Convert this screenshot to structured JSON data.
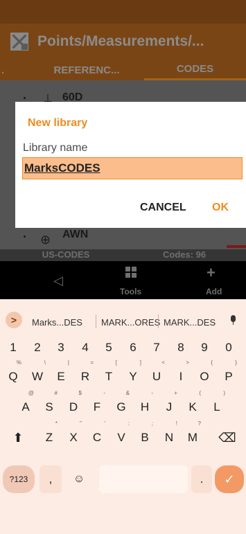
{
  "app": {
    "title": "Points/Measurements/...",
    "tabs": [
      {
        "label": "."
      },
      {
        "label": "REFERENC..."
      },
      {
        "label": "CODES"
      }
    ],
    "list": [
      {
        "code": "60D",
        "symbol": "⊥"
      },
      {
        "code": "AWN",
        "symbol": "⊕"
      }
    ],
    "footer": {
      "library": "US-CODES",
      "count": "Codes: 96"
    },
    "bottom": {
      "back_glyph": "◁",
      "tools_label": "Tools",
      "add_glyph": "+",
      "add_label": "Add"
    }
  },
  "dialog": {
    "title": "New library",
    "field_label": "Library name",
    "field_value": "MarksCODES",
    "cancel": "CANCEL",
    "ok": "OK"
  },
  "keyboard": {
    "arrow": ">",
    "suggestions": [
      "Marks...DES",
      "MARK...ORES",
      "MARK...DES"
    ],
    "row1": [
      "1",
      "2",
      "3",
      "4",
      "5",
      "6",
      "7",
      "8",
      "9",
      "0"
    ],
    "row2": [
      "Q",
      "W",
      "E",
      "R",
      "T",
      "Y",
      "U",
      "I",
      "O",
      "P"
    ],
    "row2_alt": [
      "%",
      "\\",
      "|",
      "=",
      "[",
      "]",
      "<",
      ">",
      "{",
      "}"
    ],
    "row3": [
      "A",
      "S",
      "D",
      "F",
      "G",
      "H",
      "J",
      "K",
      "L"
    ],
    "row3_alt": [
      "@",
      "#",
      "$",
      "-",
      "&",
      "-",
      "+",
      "(",
      ")"
    ],
    "row4": [
      "Z",
      "X",
      "C",
      "V",
      "B",
      "N",
      "M"
    ],
    "row4_alt": [
      "*",
      "\"",
      "'",
      ":",
      ";",
      "!",
      "?"
    ],
    "shift": "⬆",
    "backspace": "⌫",
    "sym_key": "?123",
    "comma": ",",
    "emoji": "☺",
    "period": ".",
    "enter": "✓"
  }
}
